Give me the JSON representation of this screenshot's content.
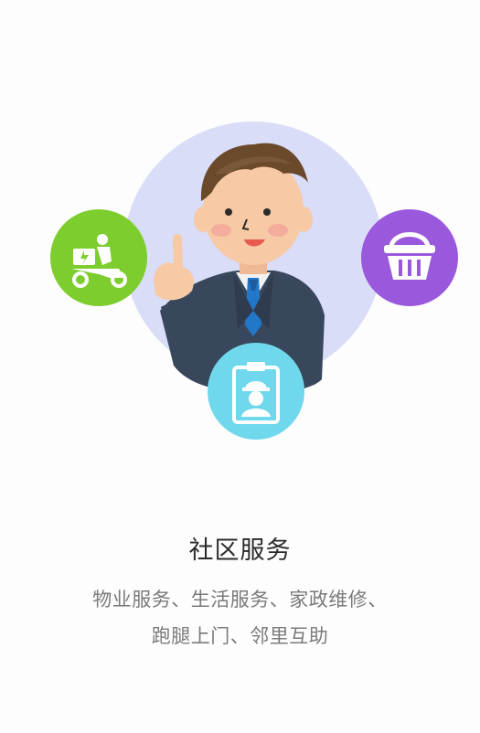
{
  "page": {
    "title": "社区服务",
    "description_lines": [
      "物业服务、生活服务、家政维修、",
      "跑腿上门、邻里互助"
    ]
  },
  "illustration": {
    "icons": [
      {
        "name": "delivery-scooter-icon",
        "color": "#7dcd2f"
      },
      {
        "name": "shopping-basket-icon",
        "color": "#9a58dd"
      },
      {
        "name": "worker-badge-icon",
        "color": "#6fd8ec"
      }
    ],
    "colors": {
      "background_circle": "#d9ddf7",
      "suit": "#39475c",
      "hair": "#6b4a2b",
      "skin": "#f7c9a4",
      "tie": "#2277c8"
    }
  }
}
